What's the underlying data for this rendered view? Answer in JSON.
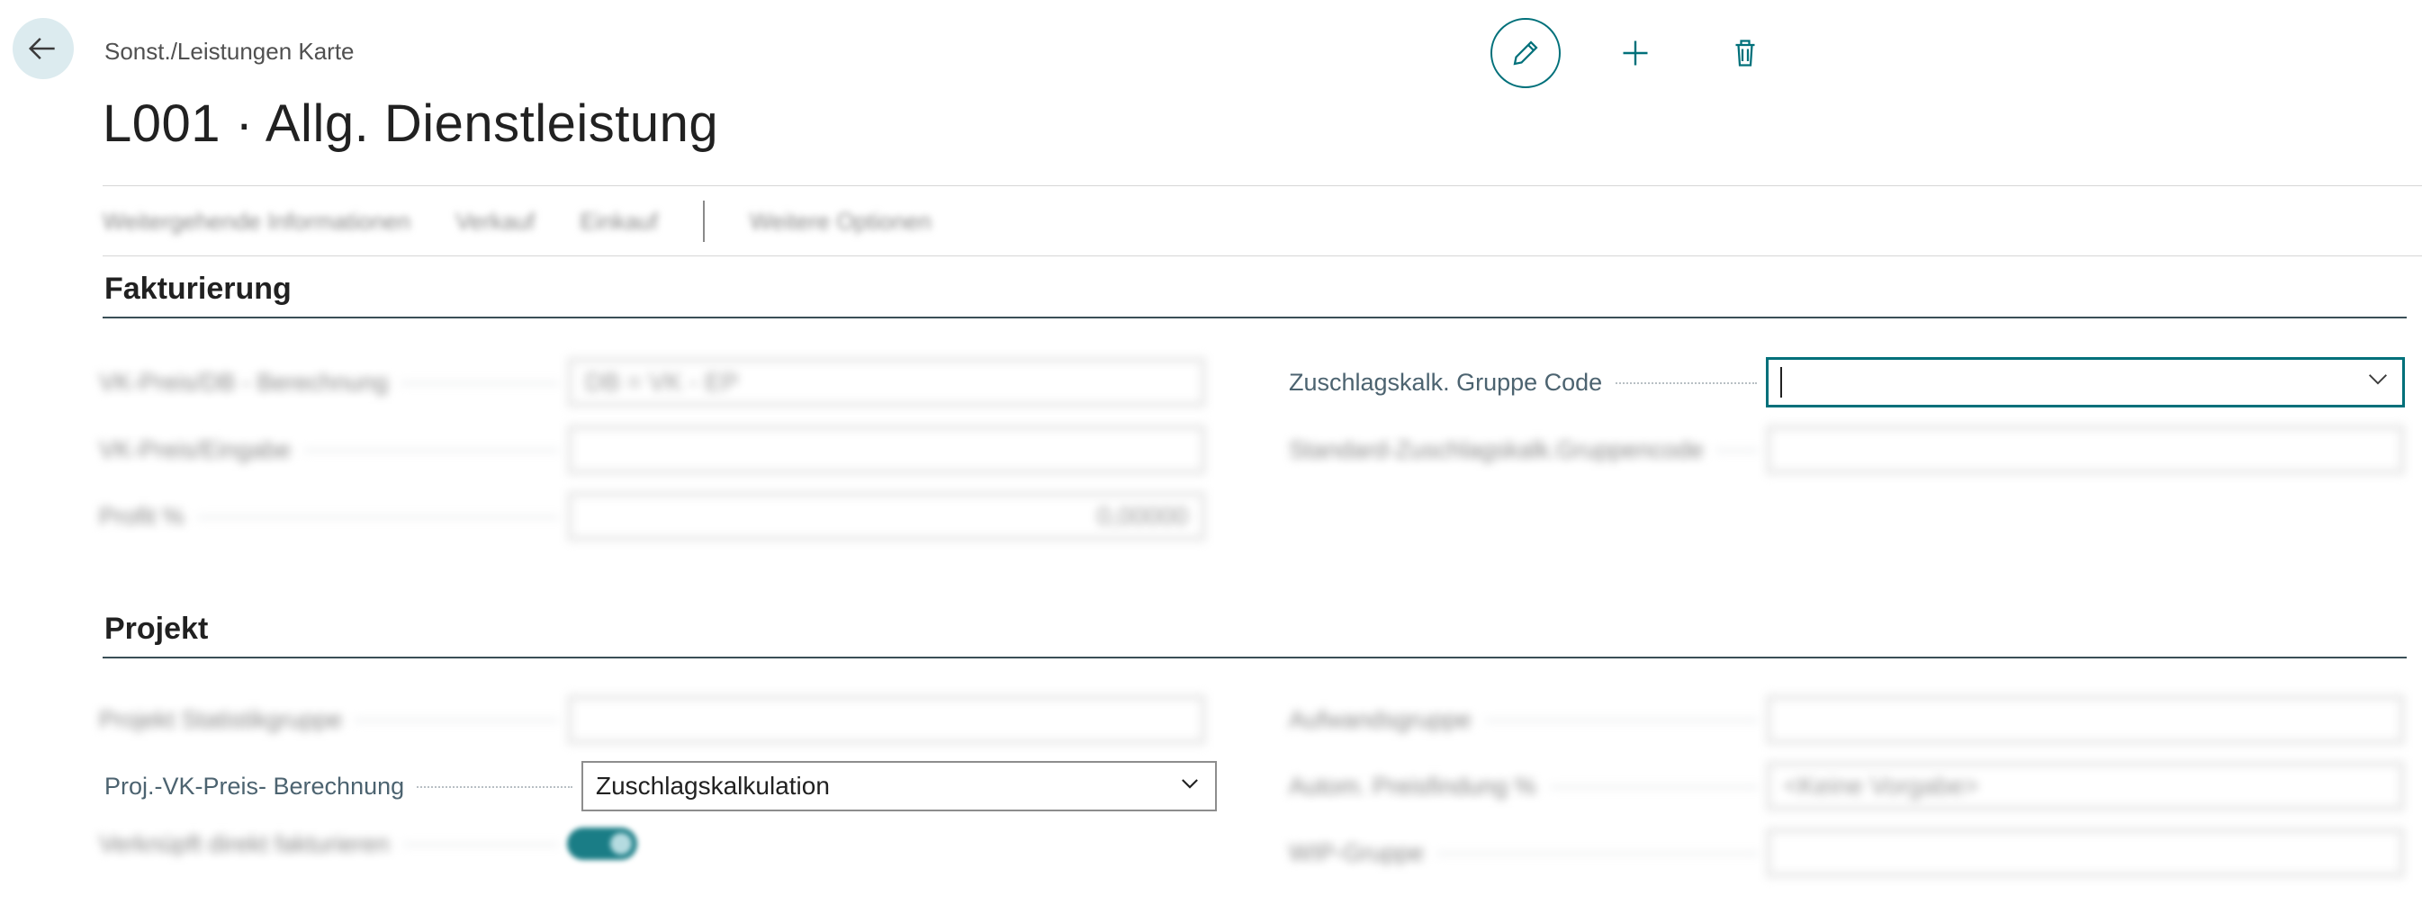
{
  "header": {
    "breadcrumb": "Sonst./Leistungen Karte",
    "title": "L001 · Allg. Dienstleistung"
  },
  "action_bar": {
    "items": [
      "Weitergehende Informationen",
      "Verkauf",
      "Einkauf"
    ],
    "extra": "Weitere Optionen"
  },
  "sections": {
    "fakturierung": {
      "title": "Fakturierung",
      "left": [
        {
          "label": "VK-Preis/DB - Berechnung",
          "value": "DB = VK - EP"
        },
        {
          "label": "VK-Preis/Eingabe",
          "value": ""
        },
        {
          "label": "Profit %",
          "value": "0,00000"
        }
      ],
      "right": [
        {
          "label": "Zuschlagskalk. Gruppe Code",
          "value": ""
        },
        {
          "label": "Standard-Zuschlagskalk.Gruppencode",
          "value": ""
        }
      ]
    },
    "projekt": {
      "title": "Projekt",
      "left": [
        {
          "label": "Projekt Statistikgruppe",
          "value": ""
        },
        {
          "label": "Proj.-VK-Preis- Berechnung",
          "value": "Zuschlagskalkulation"
        },
        {
          "label": "Verknüpft direkt fakturieren",
          "value": ""
        }
      ],
      "right": [
        {
          "label": "Aufwandsgruppe",
          "value": ""
        },
        {
          "label": "Autom. Preisfindung %",
          "value": "<Keine Vorgabe>"
        },
        {
          "label": "WIP-Gruppe",
          "value": ""
        }
      ]
    }
  },
  "colors": {
    "accent": "#00707a",
    "back_bg": "#dcebef",
    "section_rule": "#3a4f57"
  },
  "icons": [
    "back-arrow-icon",
    "pencil-icon",
    "plus-icon",
    "trash-icon",
    "chevron-down-icon"
  ]
}
